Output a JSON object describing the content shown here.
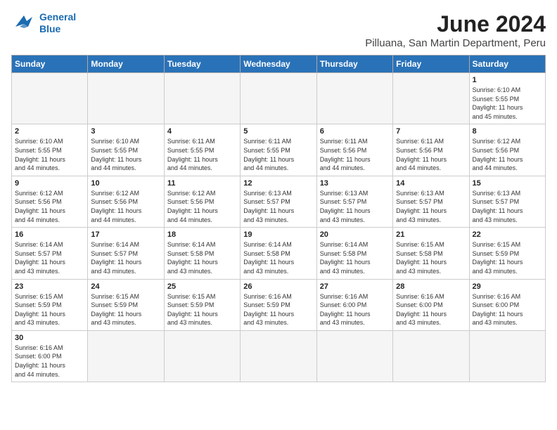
{
  "header": {
    "logo_line1": "General",
    "logo_line2": "Blue",
    "month_title": "June 2024",
    "subtitle": "Pilluana, San Martin Department, Peru"
  },
  "weekdays": [
    "Sunday",
    "Monday",
    "Tuesday",
    "Wednesday",
    "Thursday",
    "Friday",
    "Saturday"
  ],
  "weeks": [
    [
      {
        "day": "",
        "info": ""
      },
      {
        "day": "",
        "info": ""
      },
      {
        "day": "",
        "info": ""
      },
      {
        "day": "",
        "info": ""
      },
      {
        "day": "",
        "info": ""
      },
      {
        "day": "",
        "info": ""
      },
      {
        "day": "1",
        "info": "Sunrise: 6:10 AM\nSunset: 5:55 PM\nDaylight: 11 hours\nand 45 minutes."
      }
    ],
    [
      {
        "day": "2",
        "info": "Sunrise: 6:10 AM\nSunset: 5:55 PM\nDaylight: 11 hours\nand 44 minutes."
      },
      {
        "day": "3",
        "info": "Sunrise: 6:10 AM\nSunset: 5:55 PM\nDaylight: 11 hours\nand 44 minutes."
      },
      {
        "day": "4",
        "info": "Sunrise: 6:11 AM\nSunset: 5:55 PM\nDaylight: 11 hours\nand 44 minutes."
      },
      {
        "day": "5",
        "info": "Sunrise: 6:11 AM\nSunset: 5:55 PM\nDaylight: 11 hours\nand 44 minutes."
      },
      {
        "day": "6",
        "info": "Sunrise: 6:11 AM\nSunset: 5:56 PM\nDaylight: 11 hours\nand 44 minutes."
      },
      {
        "day": "7",
        "info": "Sunrise: 6:11 AM\nSunset: 5:56 PM\nDaylight: 11 hours\nand 44 minutes."
      },
      {
        "day": "8",
        "info": "Sunrise: 6:12 AM\nSunset: 5:56 PM\nDaylight: 11 hours\nand 44 minutes."
      }
    ],
    [
      {
        "day": "9",
        "info": "Sunrise: 6:12 AM\nSunset: 5:56 PM\nDaylight: 11 hours\nand 44 minutes."
      },
      {
        "day": "10",
        "info": "Sunrise: 6:12 AM\nSunset: 5:56 PM\nDaylight: 11 hours\nand 44 minutes."
      },
      {
        "day": "11",
        "info": "Sunrise: 6:12 AM\nSunset: 5:56 PM\nDaylight: 11 hours\nand 44 minutes."
      },
      {
        "day": "12",
        "info": "Sunrise: 6:13 AM\nSunset: 5:57 PM\nDaylight: 11 hours\nand 43 minutes."
      },
      {
        "day": "13",
        "info": "Sunrise: 6:13 AM\nSunset: 5:57 PM\nDaylight: 11 hours\nand 43 minutes."
      },
      {
        "day": "14",
        "info": "Sunrise: 6:13 AM\nSunset: 5:57 PM\nDaylight: 11 hours\nand 43 minutes."
      },
      {
        "day": "15",
        "info": "Sunrise: 6:13 AM\nSunset: 5:57 PM\nDaylight: 11 hours\nand 43 minutes."
      }
    ],
    [
      {
        "day": "16",
        "info": "Sunrise: 6:14 AM\nSunset: 5:57 PM\nDaylight: 11 hours\nand 43 minutes."
      },
      {
        "day": "17",
        "info": "Sunrise: 6:14 AM\nSunset: 5:57 PM\nDaylight: 11 hours\nand 43 minutes."
      },
      {
        "day": "18",
        "info": "Sunrise: 6:14 AM\nSunset: 5:58 PM\nDaylight: 11 hours\nand 43 minutes."
      },
      {
        "day": "19",
        "info": "Sunrise: 6:14 AM\nSunset: 5:58 PM\nDaylight: 11 hours\nand 43 minutes."
      },
      {
        "day": "20",
        "info": "Sunrise: 6:14 AM\nSunset: 5:58 PM\nDaylight: 11 hours\nand 43 minutes."
      },
      {
        "day": "21",
        "info": "Sunrise: 6:15 AM\nSunset: 5:58 PM\nDaylight: 11 hours\nand 43 minutes."
      },
      {
        "day": "22",
        "info": "Sunrise: 6:15 AM\nSunset: 5:59 PM\nDaylight: 11 hours\nand 43 minutes."
      }
    ],
    [
      {
        "day": "23",
        "info": "Sunrise: 6:15 AM\nSunset: 5:59 PM\nDaylight: 11 hours\nand 43 minutes."
      },
      {
        "day": "24",
        "info": "Sunrise: 6:15 AM\nSunset: 5:59 PM\nDaylight: 11 hours\nand 43 minutes."
      },
      {
        "day": "25",
        "info": "Sunrise: 6:15 AM\nSunset: 5:59 PM\nDaylight: 11 hours\nand 43 minutes."
      },
      {
        "day": "26",
        "info": "Sunrise: 6:16 AM\nSunset: 5:59 PM\nDaylight: 11 hours\nand 43 minutes."
      },
      {
        "day": "27",
        "info": "Sunrise: 6:16 AM\nSunset: 6:00 PM\nDaylight: 11 hours\nand 43 minutes."
      },
      {
        "day": "28",
        "info": "Sunrise: 6:16 AM\nSunset: 6:00 PM\nDaylight: 11 hours\nand 43 minutes."
      },
      {
        "day": "29",
        "info": "Sunrise: 6:16 AM\nSunset: 6:00 PM\nDaylight: 11 hours\nand 43 minutes."
      }
    ],
    [
      {
        "day": "30",
        "info": "Sunrise: 6:16 AM\nSunset: 6:00 PM\nDaylight: 11 hours\nand 44 minutes."
      },
      {
        "day": "",
        "info": ""
      },
      {
        "day": "",
        "info": ""
      },
      {
        "day": "",
        "info": ""
      },
      {
        "day": "",
        "info": ""
      },
      {
        "day": "",
        "info": ""
      },
      {
        "day": "",
        "info": ""
      }
    ]
  ]
}
